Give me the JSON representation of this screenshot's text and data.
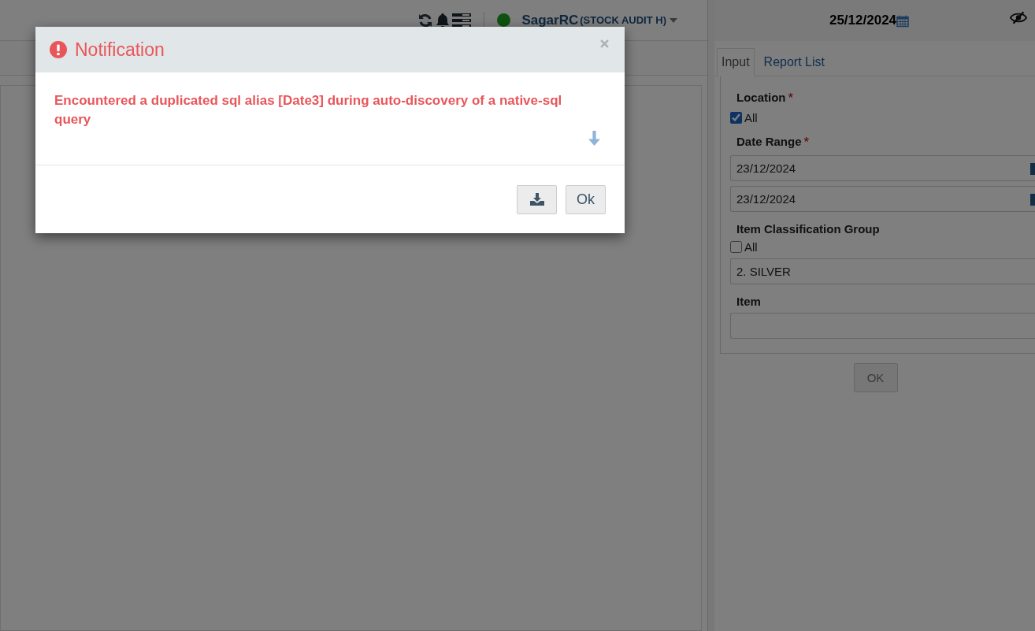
{
  "header": {
    "user": "SagarRC",
    "company": "(STOCK AUDIT H)",
    "online": true,
    "date": "25/12/2024"
  },
  "tabs": [
    {
      "label": "Input",
      "selected": true
    },
    {
      "label": "Report List",
      "selected": false
    }
  ],
  "required_mark": "*",
  "form": [
    {
      "kind": "checkbox",
      "label": "Location",
      "required": true,
      "option": "All",
      "checked": true
    },
    {
      "kind": "dates",
      "label": "Date Range",
      "required": true,
      "values": [
        "23/12/2024",
        "23/12/2024"
      ]
    },
    {
      "kind": "checkbox-select",
      "label": "Item Classification Group",
      "required": false,
      "option": "All",
      "checked": false,
      "value": "2. SILVER"
    },
    {
      "kind": "text",
      "label": "Item",
      "required": false
    }
  ],
  "submit": "OK",
  "dialog": {
    "title": "Notification",
    "message": "Encountered a duplicated sql alias [Date3] during auto-discovery of a native-sql query",
    "ok": "Ok"
  }
}
